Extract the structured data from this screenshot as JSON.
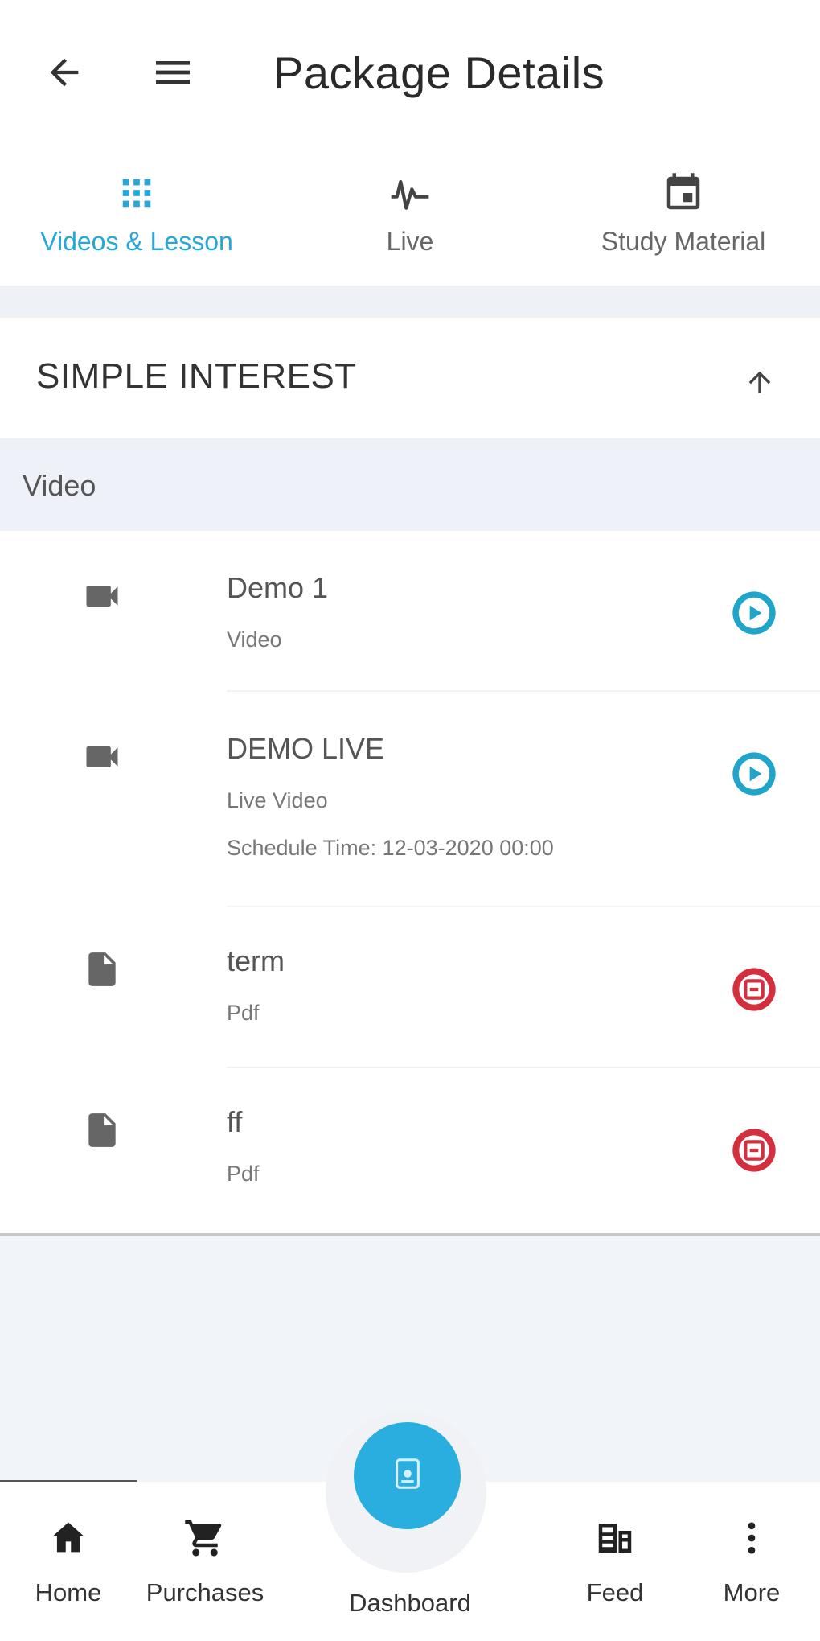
{
  "header": {
    "title": "Package Details",
    "back_icon": "arrow-left-icon",
    "menu_icon": "hamburger-menu-icon"
  },
  "tabs": [
    {
      "label": "Videos & Lesson",
      "icon": "grid-icon",
      "active": true
    },
    {
      "label": "Live",
      "icon": "pulse-icon",
      "active": false
    },
    {
      "label": "Study Material",
      "icon": "calendar-icon",
      "active": false
    }
  ],
  "section": {
    "title": "SIMPLE INTEREST",
    "toggle_icon": "arrow-up-icon"
  },
  "category": {
    "label": "Video"
  },
  "items": [
    {
      "title": "Demo 1",
      "type": "Video",
      "schedule": "",
      "icon": "video-camera-icon",
      "action": "play-icon"
    },
    {
      "title": "DEMO LIVE",
      "type": "Live Video",
      "schedule": "Schedule Time: 12-03-2020 00:00",
      "icon": "video-camera-icon",
      "action": "play-icon"
    },
    {
      "title": "term",
      "type": "Pdf",
      "schedule": "",
      "icon": "document-icon",
      "action": "pdf-icon"
    },
    {
      "title": "ff",
      "type": "Pdf",
      "schedule": "",
      "icon": "document-icon",
      "action": "pdf-icon"
    }
  ],
  "bottom_nav": {
    "items": [
      {
        "label": "Home",
        "icon": "home-icon"
      },
      {
        "label": "Purchases",
        "icon": "cart-icon"
      },
      {
        "label": "Dashboard",
        "icon": "dashboard-icon"
      },
      {
        "label": "Feed",
        "icon": "feed-icon"
      },
      {
        "label": "More",
        "icon": "more-vertical-icon"
      }
    ]
  },
  "colors": {
    "accent": "#26a7d8",
    "play": "#1ea5c9",
    "pdf": "#d32f3f",
    "fab": "#2aaee0"
  }
}
